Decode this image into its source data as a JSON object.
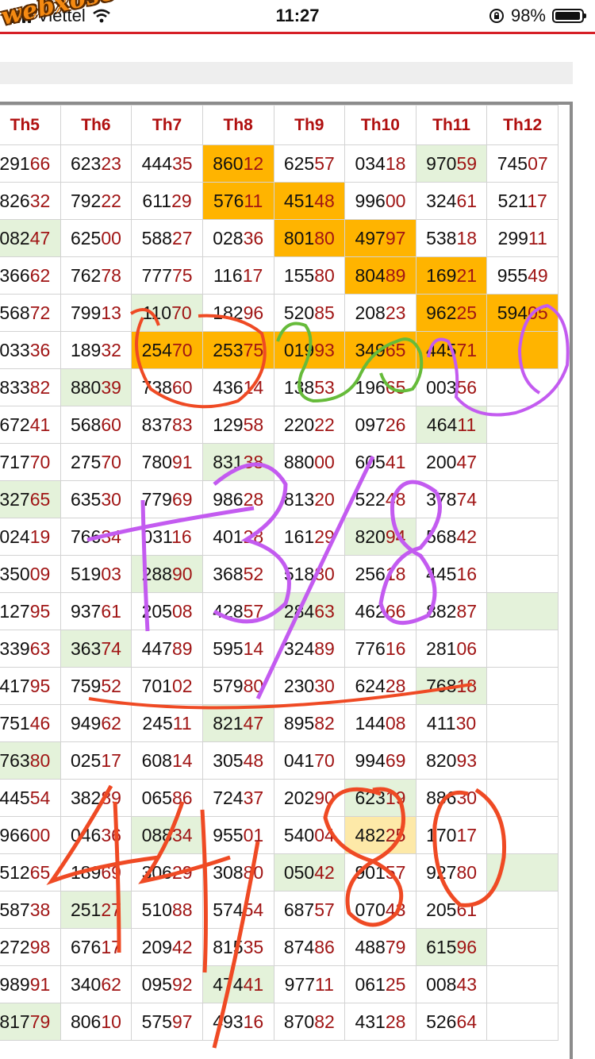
{
  "status_bar": {
    "carrier": "Viettel",
    "time": "11:27",
    "battery": "98%",
    "battery_level": 0.98
  },
  "site_logo": "webxoso.net",
  "colors": {
    "highlight": "#ffb400",
    "green_cell": "#e4f2da",
    "yellow_cell": "#fde9a8",
    "header_text": "#b01010",
    "accent_red": "#d61f26"
  },
  "table": {
    "headers": [
      "Th5",
      "Th6",
      "Th7",
      "Th8",
      "Th9",
      "Th10",
      "Th11",
      "Th12"
    ],
    "rows": [
      [
        {
          "v": "29166"
        },
        {
          "v": "62323"
        },
        {
          "v": "44435"
        },
        {
          "v": "86012",
          "s": "hl"
        },
        {
          "v": "62557"
        },
        {
          "v": "03418"
        },
        {
          "v": "97059",
          "s": "gr"
        },
        {
          "v": "74507"
        }
      ],
      [
        {
          "v": "82632"
        },
        {
          "v": "79222"
        },
        {
          "v": "61129"
        },
        {
          "v": "57611",
          "s": "hl"
        },
        {
          "v": "45148",
          "s": "hl"
        },
        {
          "v": "99600"
        },
        {
          "v": "32461"
        },
        {
          "v": "52117"
        }
      ],
      [
        {
          "v": "08247",
          "s": "gr"
        },
        {
          "v": "62500"
        },
        {
          "v": "58827"
        },
        {
          "v": "02836"
        },
        {
          "v": "80180",
          "s": "hl"
        },
        {
          "v": "49797",
          "s": "hl"
        },
        {
          "v": "53818"
        },
        {
          "v": "29911"
        }
      ],
      [
        {
          "v": "36662"
        },
        {
          "v": "76278"
        },
        {
          "v": "77775"
        },
        {
          "v": "11617"
        },
        {
          "v": "15580"
        },
        {
          "v": "80489",
          "s": "hl"
        },
        {
          "v": "16921",
          "s": "hl"
        },
        {
          "v": "95549"
        }
      ],
      [
        {
          "v": "56872"
        },
        {
          "v": "79913"
        },
        {
          "v": "11070",
          "s": "gr"
        },
        {
          "v": "18296"
        },
        {
          "v": "52085"
        },
        {
          "v": "20823"
        },
        {
          "v": "96225",
          "s": "hl"
        },
        {
          "v": "59405",
          "s": "hl"
        }
      ],
      [
        {
          "v": "03336"
        },
        {
          "v": "18932"
        },
        {
          "v": "25470",
          "s": "hl"
        },
        {
          "v": "25375",
          "s": "hl"
        },
        {
          "v": "01993",
          "s": "hl"
        },
        {
          "v": "34965",
          "s": "hl"
        },
        {
          "v": "44571",
          "s": "hl"
        },
        {
          "v": "",
          "s": "hl"
        }
      ],
      [
        {
          "v": "83382"
        },
        {
          "v": "88039",
          "s": "gr"
        },
        {
          "v": "73860"
        },
        {
          "v": "43614"
        },
        {
          "v": "13853"
        },
        {
          "v": "19665"
        },
        {
          "v": "00356"
        },
        {
          "v": ""
        }
      ],
      [
        {
          "v": "67241"
        },
        {
          "v": "56860"
        },
        {
          "v": "83783"
        },
        {
          "v": "12958"
        },
        {
          "v": "22022"
        },
        {
          "v": "09726"
        },
        {
          "v": "46411",
          "s": "gr"
        },
        {
          "v": ""
        }
      ],
      [
        {
          "v": "71770"
        },
        {
          "v": "27570"
        },
        {
          "v": "78091"
        },
        {
          "v": "83138",
          "s": "gr"
        },
        {
          "v": "88000"
        },
        {
          "v": "60541"
        },
        {
          "v": "20047"
        },
        {
          "v": ""
        }
      ],
      [
        {
          "v": "32765",
          "s": "gr"
        },
        {
          "v": "63530"
        },
        {
          "v": "77969"
        },
        {
          "v": "98628"
        },
        {
          "v": "81320"
        },
        {
          "v": "52248"
        },
        {
          "v": "37874"
        },
        {
          "v": ""
        }
      ],
      [
        {
          "v": "02419"
        },
        {
          "v": "76634"
        },
        {
          "v": "03116"
        },
        {
          "v": "40128"
        },
        {
          "v": "16129"
        },
        {
          "v": "82094",
          "s": "gr"
        },
        {
          "v": "56842"
        },
        {
          "v": ""
        }
      ],
      [
        {
          "v": "35009"
        },
        {
          "v": "51903"
        },
        {
          "v": "28890",
          "s": "gr"
        },
        {
          "v": "36852"
        },
        {
          "v": "51880"
        },
        {
          "v": "25618"
        },
        {
          "v": "44516"
        },
        {
          "v": ""
        }
      ],
      [
        {
          "v": "12795"
        },
        {
          "v": "93761"
        },
        {
          "v": "20508"
        },
        {
          "v": "42857"
        },
        {
          "v": "28463",
          "s": "gr"
        },
        {
          "v": "46266"
        },
        {
          "v": "88287"
        },
        {
          "v": "",
          "s": "gr"
        }
      ],
      [
        {
          "v": "33963"
        },
        {
          "v": "36374",
          "s": "gr"
        },
        {
          "v": "44789"
        },
        {
          "v": "59514"
        },
        {
          "v": "32489"
        },
        {
          "v": "77616"
        },
        {
          "v": "28106"
        },
        {
          "v": ""
        }
      ],
      [
        {
          "v": "41795"
        },
        {
          "v": "75952"
        },
        {
          "v": "70102"
        },
        {
          "v": "57980"
        },
        {
          "v": "23030"
        },
        {
          "v": "62428"
        },
        {
          "v": "76818",
          "s": "gr"
        },
        {
          "v": ""
        }
      ],
      [
        {
          "v": "75146"
        },
        {
          "v": "94962"
        },
        {
          "v": "24511"
        },
        {
          "v": "82147",
          "s": "gr"
        },
        {
          "v": "89582"
        },
        {
          "v": "14408"
        },
        {
          "v": "41130"
        },
        {
          "v": ""
        }
      ],
      [
        {
          "v": "76380",
          "s": "gr"
        },
        {
          "v": "02517"
        },
        {
          "v": "60814"
        },
        {
          "v": "30548"
        },
        {
          "v": "04170"
        },
        {
          "v": "99469"
        },
        {
          "v": "82093"
        },
        {
          "v": ""
        }
      ],
      [
        {
          "v": "44554"
        },
        {
          "v": "38289"
        },
        {
          "v": "06586"
        },
        {
          "v": "72437"
        },
        {
          "v": "20290"
        },
        {
          "v": "62319",
          "s": "gr"
        },
        {
          "v": "88630"
        },
        {
          "v": ""
        }
      ],
      [
        {
          "v": "96600"
        },
        {
          "v": "04636"
        },
        {
          "v": "08834",
          "s": "gr"
        },
        {
          "v": "95501"
        },
        {
          "v": "54004"
        },
        {
          "v": "48225",
          "s": "yl"
        },
        {
          "v": "17017"
        },
        {
          "v": ""
        }
      ],
      [
        {
          "v": "51265"
        },
        {
          "v": "18969"
        },
        {
          "v": "30629"
        },
        {
          "v": "30880"
        },
        {
          "v": "05042",
          "s": "gr"
        },
        {
          "v": "90157"
        },
        {
          "v": "92780"
        },
        {
          "v": "",
          "s": "gr"
        }
      ],
      [
        {
          "v": "58738"
        },
        {
          "v": "25127",
          "s": "gr"
        },
        {
          "v": "51088"
        },
        {
          "v": "57454"
        },
        {
          "v": "68757"
        },
        {
          "v": "07043"
        },
        {
          "v": "20561"
        },
        {
          "v": ""
        }
      ],
      [
        {
          "v": "27298"
        },
        {
          "v": "67617"
        },
        {
          "v": "20942"
        },
        {
          "v": "81535"
        },
        {
          "v": "87486"
        },
        {
          "v": "48879"
        },
        {
          "v": "61596",
          "s": "gr"
        },
        {
          "v": ""
        }
      ],
      [
        {
          "v": "98991"
        },
        {
          "v": "34062"
        },
        {
          "v": "09592"
        },
        {
          "v": "47441",
          "s": "gr"
        },
        {
          "v": "97711"
        },
        {
          "v": "06125"
        },
        {
          "v": "00843"
        },
        {
          "v": ""
        }
      ],
      [
        {
          "v": "81779",
          "s": "gr"
        },
        {
          "v": "80610"
        },
        {
          "v": "57597"
        },
        {
          "v": "49316"
        },
        {
          "v": "87082"
        },
        {
          "v": "43128"
        },
        {
          "v": "52664"
        },
        {
          "v": ""
        }
      ]
    ]
  },
  "annotations": {
    "handwriting": [
      "+3/8",
      "44/80"
    ],
    "red_ink": "#ef4a24",
    "purple_ink": "#c35bf0",
    "green_ink": "#66bb3a"
  }
}
